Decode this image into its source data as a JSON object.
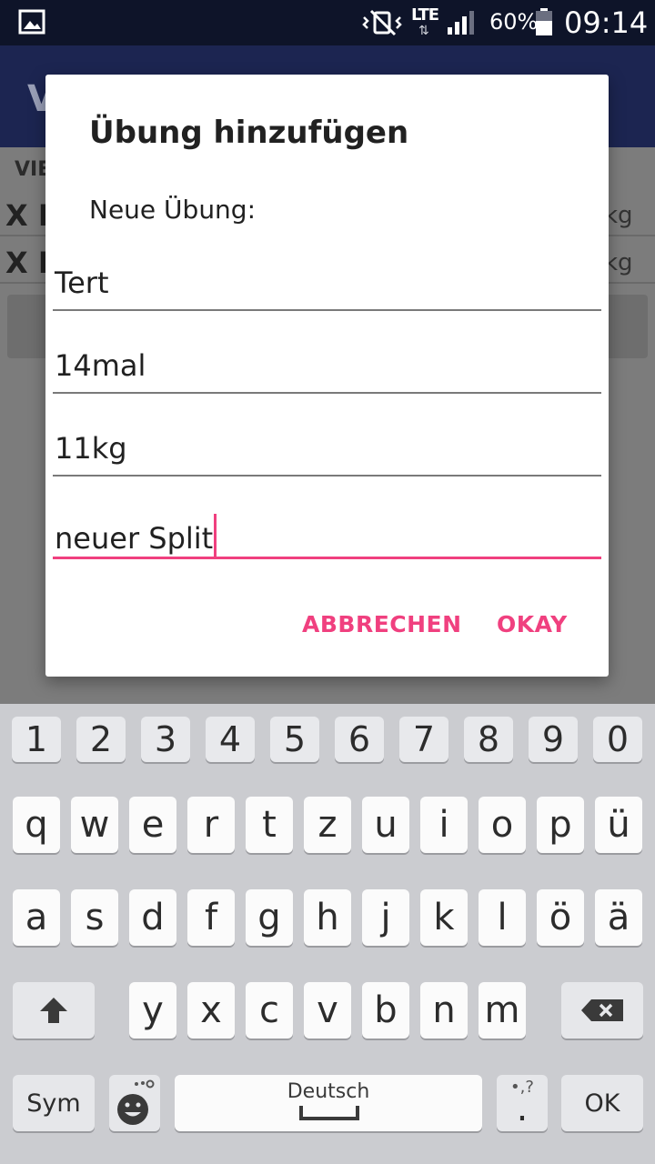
{
  "status_bar": {
    "network": "LTE",
    "battery": "60%",
    "time": "09:14"
  },
  "background_app": {
    "title_fragment": "V",
    "header_fragment": "VIE",
    "rows": [
      {
        "lead": "X E",
        "trail": "kg"
      },
      {
        "lead": "X E",
        "trail": "kg"
      }
    ]
  },
  "dialog": {
    "title": "Übung hinzufügen",
    "message": "Neue Übung:",
    "fields": [
      {
        "value": "Tert"
      },
      {
        "value": "14mal"
      },
      {
        "value": "11kg"
      },
      {
        "value": "neuer Split"
      }
    ],
    "cancel_label": "ABBRECHEN",
    "ok_label": "OKAY",
    "accent_color": "#f0407f"
  },
  "keyboard": {
    "number_row": [
      "1",
      "2",
      "3",
      "4",
      "5",
      "6",
      "7",
      "8",
      "9",
      "0"
    ],
    "row1": [
      "q",
      "w",
      "e",
      "r",
      "t",
      "z",
      "u",
      "i",
      "o",
      "p",
      "ü"
    ],
    "row2": [
      "a",
      "s",
      "d",
      "f",
      "g",
      "h",
      "j",
      "k",
      "l",
      "ö",
      "ä"
    ],
    "row3": [
      "y",
      "x",
      "c",
      "v",
      "b",
      "n",
      "m"
    ],
    "sym_label": "Sym",
    "space_label": "Deutsch",
    "ok_label": "OK",
    "punct_hint": "•,?",
    "punct_main": "."
  }
}
